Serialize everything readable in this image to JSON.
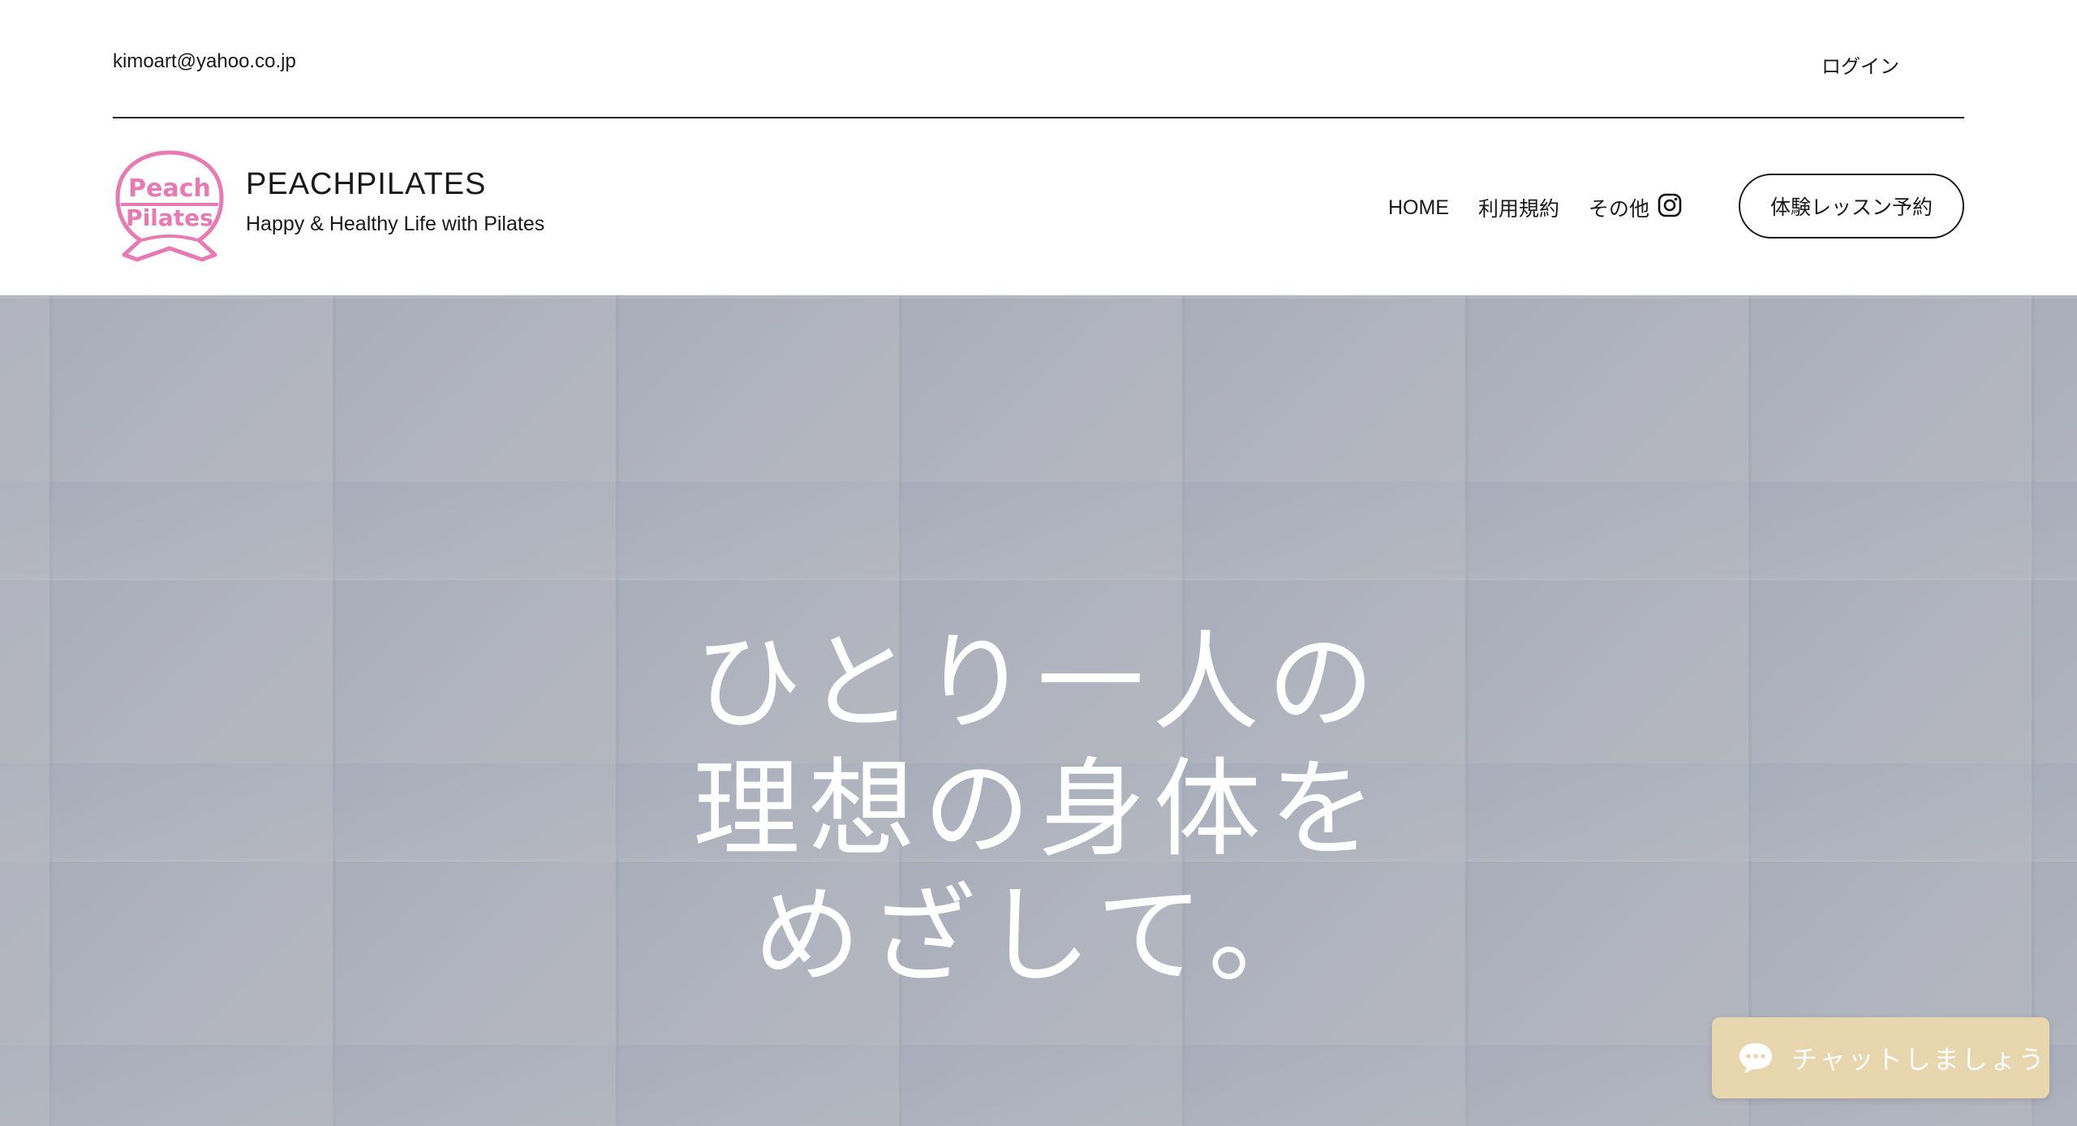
{
  "topbar": {
    "email": "kimoart@yahoo.co.jp",
    "login_label": "ログイン"
  },
  "brand": {
    "logo_text_line1": "Peach",
    "logo_text_line2": "Pilates",
    "title": "PEACHPILATES",
    "tagline": "Happy & Healthy Life with Pilates",
    "logo_color": "#e879b3"
  },
  "nav": {
    "items": [
      {
        "label": "HOME"
      },
      {
        "label": "利用規約"
      },
      {
        "label": "その他"
      }
    ],
    "instagram_icon": "instagram-icon",
    "cta_label": "体験レッスン予約"
  },
  "hero": {
    "lines": [
      "ひとり一人の",
      "理想の身体を",
      "めざして。"
    ],
    "background_color": "#a9adb8"
  },
  "chat": {
    "label": "チャットしましょう",
    "icon": "chat-bubble-icon",
    "color": "#e8d6ae"
  }
}
